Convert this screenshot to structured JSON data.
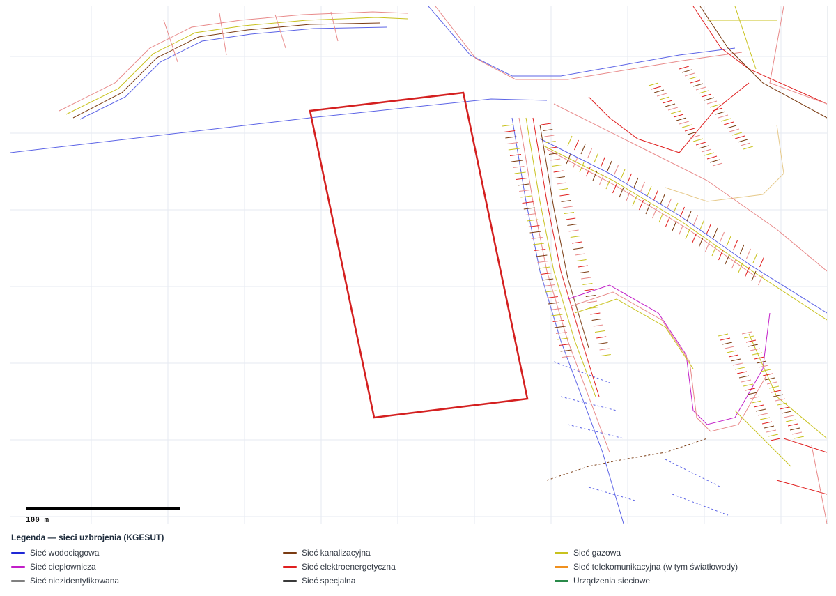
{
  "map": {
    "scale": {
      "label": "100 m"
    },
    "boundary_color": "#d42020",
    "grid_color": "#e6eaf2"
  },
  "legend": {
    "title": "Legenda — sieci uzbrojenia (KGESUT)",
    "items": [
      {
        "label": "Sieć wodociągowa",
        "color": "#1f28d6"
      },
      {
        "label": "Sieć kanalizacyjna",
        "color": "#7a3b12"
      },
      {
        "label": "Sieć gazowa",
        "color": "#c8c21e"
      },
      {
        "label": "Sieć ciepłownicza",
        "color": "#c21ec8"
      },
      {
        "label": "Sieć elektroenergetyczna",
        "color": "#e02020"
      },
      {
        "label": "Sieć telekomunikacyjna (w tym światłowody)",
        "color": "#f0901e"
      },
      {
        "label": "Sieć niezidentyfikowana",
        "color": "#808080"
      },
      {
        "label": "Sieć specjalna",
        "color": "#3a3a3a"
      },
      {
        "label": "Urządzenia sieciowe",
        "color": "#2a8a4a"
      }
    ]
  }
}
